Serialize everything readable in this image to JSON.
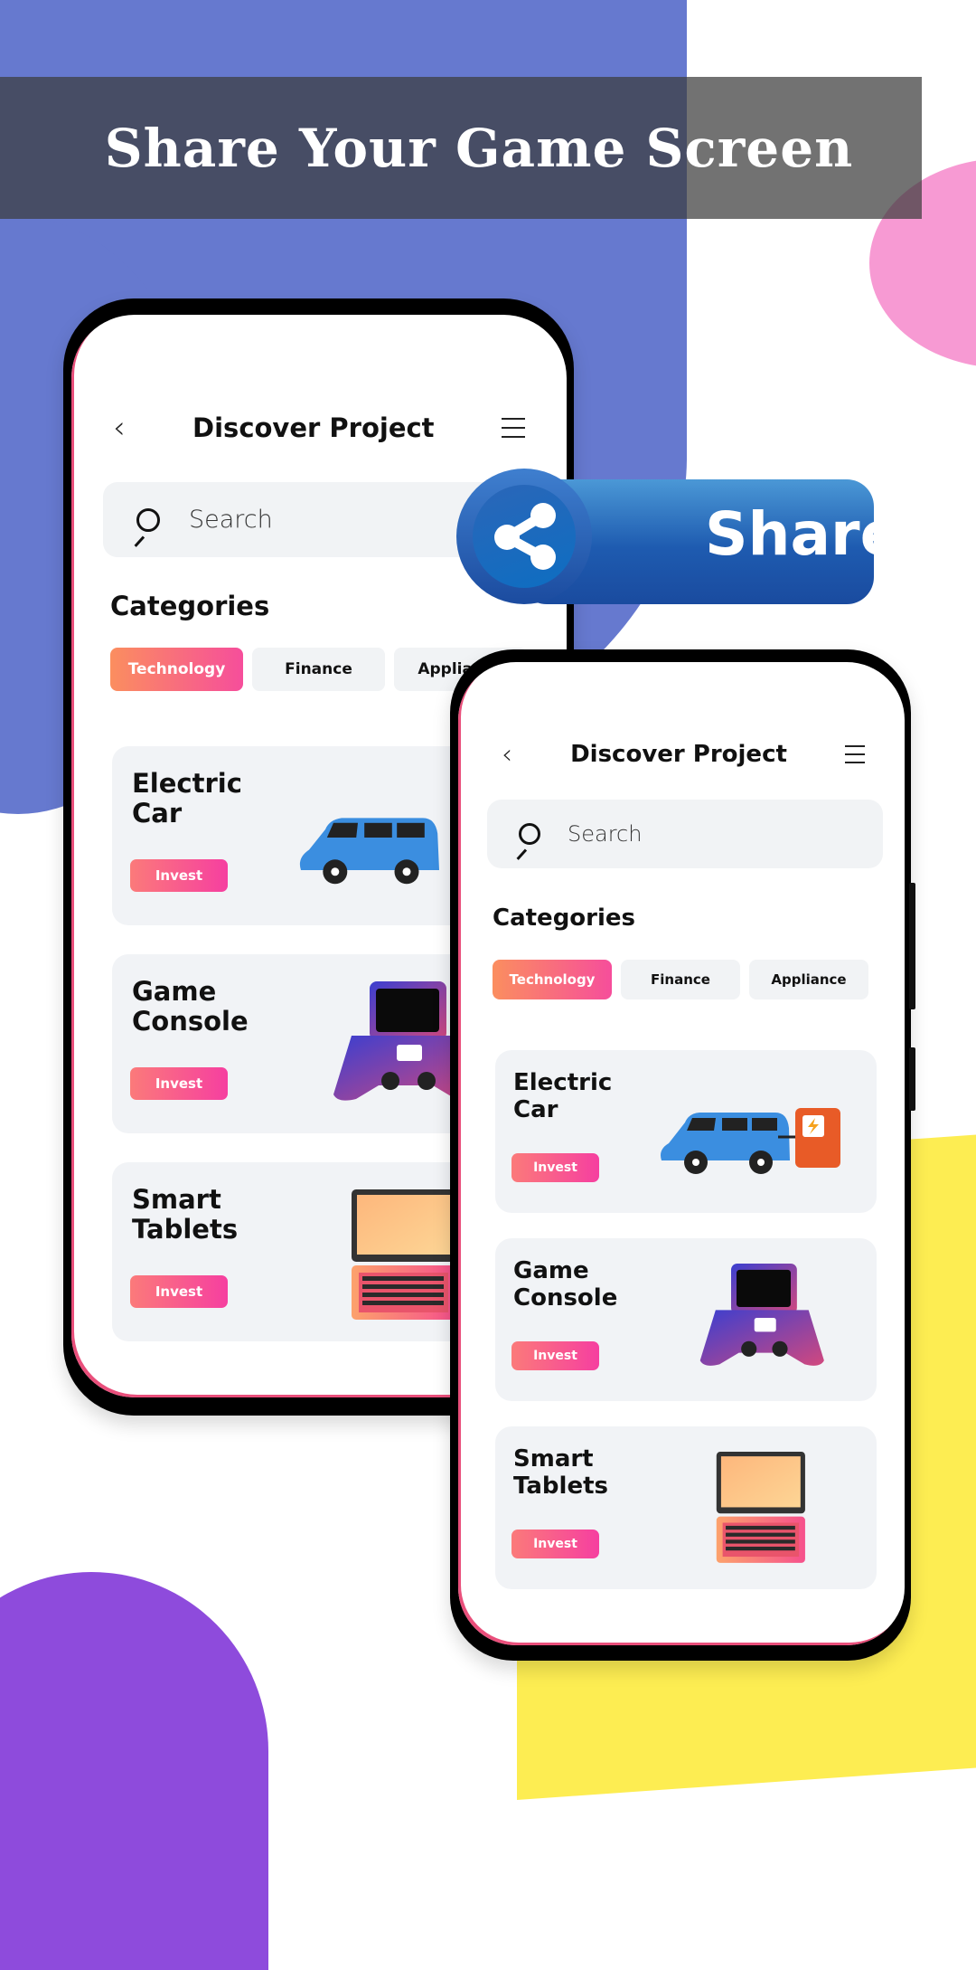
{
  "banner": {
    "title": "Share Your Game Screen"
  },
  "share_button": {
    "label": "Share",
    "icon": "share-icon"
  },
  "colors": {
    "blob_blue": "#6679cf",
    "blob_pink": "#f79ad3",
    "blob_purple": "#8e4bdc",
    "blob_yellow": "#fded52",
    "chip_active_gradient": [
      "#fb8e5f",
      "#f64e9b"
    ],
    "invest_gradient": [
      "#fb7a7a",
      "#f63fa0"
    ],
    "share_blue": "#1e5bb0"
  },
  "phones": [
    {
      "id": "left",
      "header": {
        "back_icon": "chevron-left-icon",
        "title": "Discover Project",
        "menu_icon": "hamburger-menu-icon"
      },
      "search": {
        "placeholder": "Search",
        "icon": "search-icon"
      },
      "categories_label": "Categories",
      "chips": [
        {
          "label": "Technology",
          "active": true
        },
        {
          "label": "Finance",
          "active": false
        },
        {
          "label": "Appliance",
          "active": false
        }
      ],
      "cards": [
        {
          "title": "Electric\nCar",
          "button": "Invest",
          "illustration": "electric-car-icon"
        },
        {
          "title": "Game\nConsole",
          "button": "Invest",
          "illustration": "game-console-icon"
        },
        {
          "title": "Smart\nTablets",
          "button": "Invest",
          "illustration": "laptop-icon"
        }
      ]
    },
    {
      "id": "right",
      "header": {
        "back_icon": "chevron-left-icon",
        "title": "Discover Project",
        "menu_icon": "hamburger-menu-icon"
      },
      "search": {
        "placeholder": "Search",
        "icon": "search-icon"
      },
      "categories_label": "Categories",
      "chips": [
        {
          "label": "Technology",
          "active": true
        },
        {
          "label": "Finance",
          "active": false
        },
        {
          "label": "Appliance",
          "active": false
        }
      ],
      "cards": [
        {
          "title": "Electric\nCar",
          "button": "Invest",
          "illustration": "electric-car-icon"
        },
        {
          "title": "Game\nConsole",
          "button": "Invest",
          "illustration": "game-console-icon"
        },
        {
          "title": "Smart\nTablets",
          "button": "Invest",
          "illustration": "laptop-icon"
        }
      ]
    }
  ]
}
